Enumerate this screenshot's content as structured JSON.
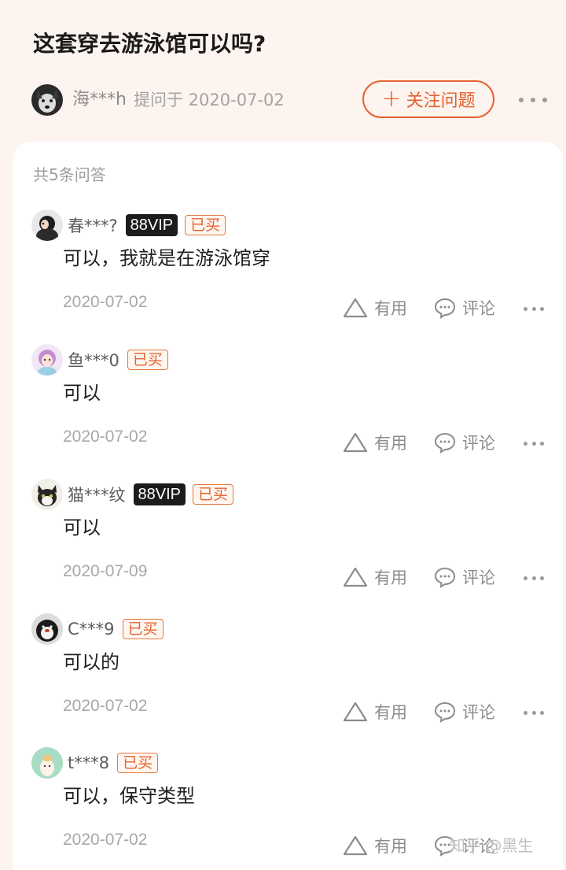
{
  "question": {
    "title": "这套穿去游泳馆可以吗?",
    "asker_name": "海***h",
    "asked_label": "提问于 2020-07-02",
    "follow_label": "关注问题",
    "follow_plus": "+"
  },
  "answers_count_label": "共5条问答",
  "actions": {
    "useful_label": "有用",
    "comment_label": "评论"
  },
  "answers": [
    {
      "name": "春***?",
      "vip": "88VIP",
      "bought": "已买",
      "text": "可以，我就是在游泳馆穿",
      "date": "2020-07-02"
    },
    {
      "name": "鱼***0",
      "vip": "",
      "bought": "已买",
      "text": "可以",
      "date": "2020-07-02"
    },
    {
      "name": "猫***纹",
      "vip": "88VIP",
      "bought": "已买",
      "text": "可以",
      "date": "2020-07-09"
    },
    {
      "name": "C***9",
      "vip": "",
      "bought": "已买",
      "text": "可以的",
      "date": "2020-07-02"
    },
    {
      "name": "t***8",
      "vip": "",
      "bought": "已买",
      "text": "可以，保守类型",
      "date": "2020-07-02"
    }
  ],
  "watermark": "知乎 @黑生",
  "colors": {
    "accent": "#e4622e",
    "header_bg": "#fdf3ef",
    "card_bg": "#ffffff"
  }
}
